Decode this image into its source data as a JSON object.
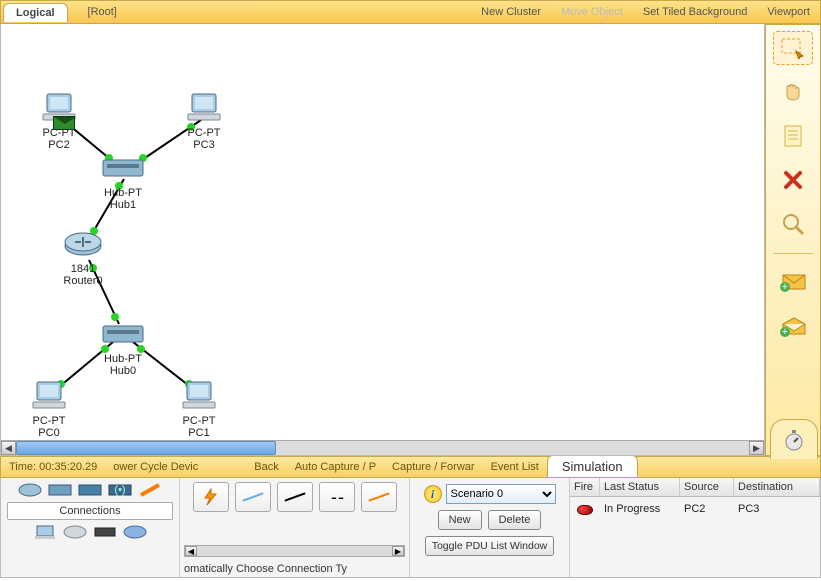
{
  "topbar": {
    "logical": "Logical",
    "root": "[Root]",
    "new_cluster": "New Cluster",
    "move_object": "Move Object",
    "set_bg": "Set Tiled Background",
    "viewport": "Viewport"
  },
  "midbar": {
    "time_label": "Time: 00:35:20.29",
    "power": "ower Cycle Devic",
    "back": "Back",
    "auto": "Auto Capture / P",
    "capture": "Capture / Forwar",
    "eventlist": "Event List",
    "simulation": "Simulation"
  },
  "rtools": {
    "select": "select-marquee",
    "hand": "hand",
    "note": "note",
    "delete": "delete",
    "inspect": "magnify",
    "add_simple": "add-simple-pdu",
    "add_complex": "add-complex-pdu"
  },
  "devcat_label": "Connections",
  "connections_footer": "omatically Choose Connection Ty",
  "scenario": {
    "selected": "Scenario 0",
    "new": "New",
    "delete": "Delete",
    "toggle": "Toggle PDU List Window"
  },
  "pdu": {
    "headers": {
      "fire": "Fire",
      "last": "Last Status",
      "src": "Source",
      "dst": "Destination"
    },
    "rows": [
      {
        "fire": true,
        "last": "In Progress",
        "src": "PC2",
        "dst": "PC3"
      }
    ]
  },
  "devices": {
    "pc2": {
      "name": "PC-PT",
      "sub": "PC2"
    },
    "pc3": {
      "name": "PC-PT",
      "sub": "PC3"
    },
    "hub1": {
      "name": "Hub-PT",
      "sub": "Hub1"
    },
    "router": {
      "name": "1841",
      "sub": "Router0"
    },
    "hub0": {
      "name": "Hub-PT",
      "sub": "Hub0"
    },
    "pc0": {
      "name": "PC-PT",
      "sub": "PC0"
    },
    "pc1": {
      "name": "PC-PT",
      "sub": "PC1"
    }
  }
}
